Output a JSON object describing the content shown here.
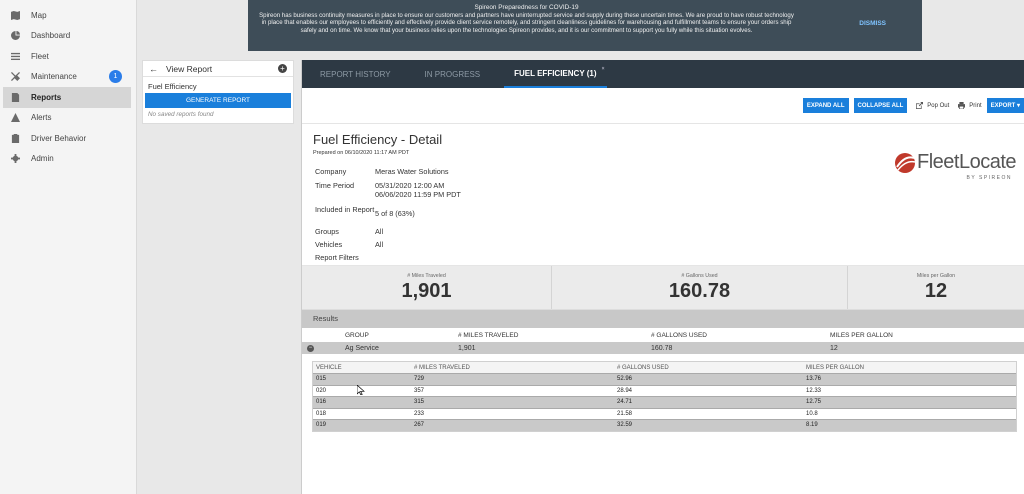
{
  "sidebar": {
    "items": [
      {
        "label": "Map",
        "icon": "map-icon"
      },
      {
        "label": "Dashboard",
        "icon": "dashboard-icon"
      },
      {
        "label": "Fleet",
        "icon": "list-icon"
      },
      {
        "label": "Maintenance",
        "icon": "wrench-icon",
        "badge": "1"
      },
      {
        "label": "Reports",
        "icon": "report-icon"
      },
      {
        "label": "Alerts",
        "icon": "alert-icon"
      },
      {
        "label": "Driver Behavior",
        "icon": "clipboard-icon"
      },
      {
        "label": "Admin",
        "icon": "gear-icon"
      }
    ]
  },
  "banner": {
    "title": "Spireon Preparedness for COVID-19",
    "body": "Spireon has business continuity measures in place to ensure our customers and partners have uninterrupted service and supply during these uncertain times. We are proud to have robust technology in place that enables our employees to efficiently and effectively provide client service remotely, and stringent cleanliness guidelines for warehousing and fulfillment teams to ensure your orders ship safely and on time. We know that your business relies upon the technologies Spireon provides, and it is our commitment to support you fully while this situation evolves.",
    "dismiss": "DISMISS"
  },
  "report_panel": {
    "title": "View Report",
    "report_name": "Fuel Efficiency",
    "generate": "GENERATE REPORT",
    "empty": "No saved reports found"
  },
  "tabs": [
    "REPORT HISTORY",
    "IN PROGRESS",
    "FUEL EFFICIENCY (1)"
  ],
  "toolbar": {
    "expand": "EXPAND ALL",
    "collapse": "COLLAPSE ALL",
    "popout": "Pop Out",
    "print": "Print",
    "export": "EXPORT"
  },
  "detail": {
    "title": "Fuel Efficiency - Detail",
    "prepared": "Prepared on 06/10/2020 11:17 AM    PDT",
    "meta": [
      {
        "k": "Company",
        "v": "Meras Water Solutions"
      },
      {
        "k": "Time Period",
        "v": "05/31/2020 12:00 AM\n06/06/2020 11:59 PM    PDT"
      },
      {
        "k": "Included in Report",
        "v": "5 of 8 (63%)"
      },
      {
        "k": "Groups",
        "v": "All"
      },
      {
        "k": "Vehicles",
        "v": "All"
      },
      {
        "k": "Report Filters",
        "v": ""
      }
    ],
    "logo_text": "FleetLocate",
    "logo_sub": "BY SPIREON"
  },
  "stats": [
    {
      "label": "# Miles Traveled",
      "value": "1,901"
    },
    {
      "label": "# Gallons Used",
      "value": "160.78"
    },
    {
      "label": "Miles per Gallon",
      "value": "12"
    }
  ],
  "results": {
    "label": "Results",
    "group_headers": [
      "GROUP",
      "# MILES TRAVELED",
      "# GALLONS USED",
      "MILES PER GALLON"
    ],
    "group": {
      "name": "Ag Service",
      "miles": "1,901",
      "gallons": "160.78",
      "mpg": "12"
    },
    "vehicle_headers": [
      "VEHICLE",
      "# MILES TRAVELED",
      "# GALLONS USED",
      "MILES PER GALLON"
    ],
    "vehicles": [
      {
        "id": "015",
        "miles": "729",
        "gallons": "52.96",
        "mpg": "13.76"
      },
      {
        "id": "020",
        "miles": "357",
        "gallons": "28.94",
        "mpg": "12.33"
      },
      {
        "id": "016",
        "miles": "315",
        "gallons": "24.71",
        "mpg": "12.75"
      },
      {
        "id": "018",
        "miles": "233",
        "gallons": "21.58",
        "mpg": "10.8"
      },
      {
        "id": "019",
        "miles": "267",
        "gallons": "32.59",
        "mpg": "8.19"
      }
    ]
  }
}
